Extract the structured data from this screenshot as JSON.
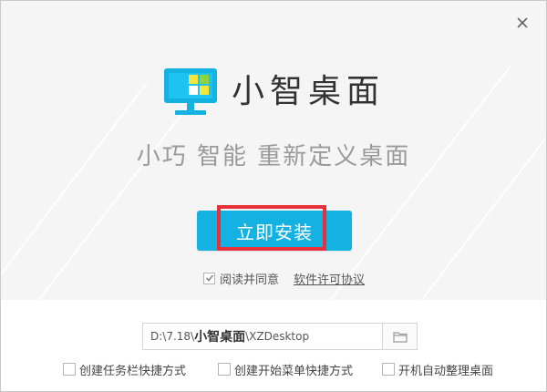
{
  "window": {
    "close_icon": "close-icon"
  },
  "brand": {
    "app_name": "小智桌面",
    "slogan": "小巧 智能 重新定义桌面",
    "logo_icon": "monitor-icon",
    "colors": {
      "accent": "#14b2e2",
      "logo_yellow": "#f5e63a",
      "logo_green": "#8ed23c",
      "highlight": "#e8303a"
    }
  },
  "install": {
    "button_label": "立即安装"
  },
  "agreement": {
    "checked": true,
    "label": "阅读并同意",
    "link_label": "软件许可协议"
  },
  "install_path": {
    "prefix": "D:\\7.18\\",
    "bold": "小智桌面",
    "suffix": "\\XZDesktop",
    "browse_icon": "folder-icon"
  },
  "options": [
    {
      "label": "创建任务栏快捷方式",
      "checked": false
    },
    {
      "label": "创建开始菜单快捷方式",
      "checked": false
    },
    {
      "label": "开机自动整理桌面",
      "checked": false
    }
  ]
}
